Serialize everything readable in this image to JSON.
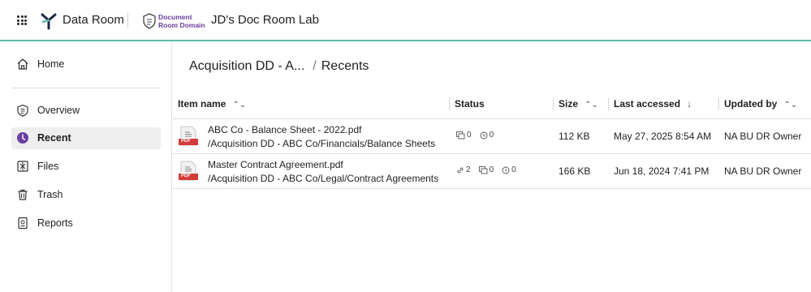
{
  "topbar": {
    "app_name": "Data Room",
    "domain_line1": "Document",
    "domain_line2": "Room Domain",
    "room_title": "JD's Doc Room Lab",
    "accent": "#5fb9b0"
  },
  "sidebar": {
    "items": [
      {
        "label": "Home",
        "icon": "home-icon"
      },
      {
        "label": "Overview",
        "icon": "overview-icon"
      },
      {
        "label": "Recent",
        "icon": "clock-icon",
        "active": true
      },
      {
        "label": "Files",
        "icon": "files-icon"
      },
      {
        "label": "Trash",
        "icon": "trash-icon"
      },
      {
        "label": "Reports",
        "icon": "reports-icon"
      }
    ],
    "active_color": "#6b3fa0"
  },
  "breadcrumb": {
    "parent": "Acquisition DD - A...",
    "separator": "/",
    "current": "Recents"
  },
  "table": {
    "columns": [
      "Item name",
      "Status",
      "Size",
      "Last accessed",
      "Updated by"
    ],
    "rows": [
      {
        "name": "ABC Co - Balance Sheet - 2022.pdf",
        "path": "/Acquisition DD - ABC Co/Financials/Balance Sheets",
        "type": "PDF",
        "comments": "0",
        "versions": "0",
        "size": "112 KB",
        "last_accessed": "May 27, 2025 8:54 AM",
        "updated_by": "NA BU DR Owner"
      },
      {
        "name": "Master Contract Agreement.pdf",
        "path": "/Acquisition DD - ABC Co/Legal/Contract Agreements",
        "type": "PDF",
        "links": "2",
        "comments": "0",
        "versions": "0",
        "size": "166 KB",
        "last_accessed": "Jun 18, 2024 7:41 PM",
        "updated_by": "NA BU DR Owner"
      }
    ]
  }
}
